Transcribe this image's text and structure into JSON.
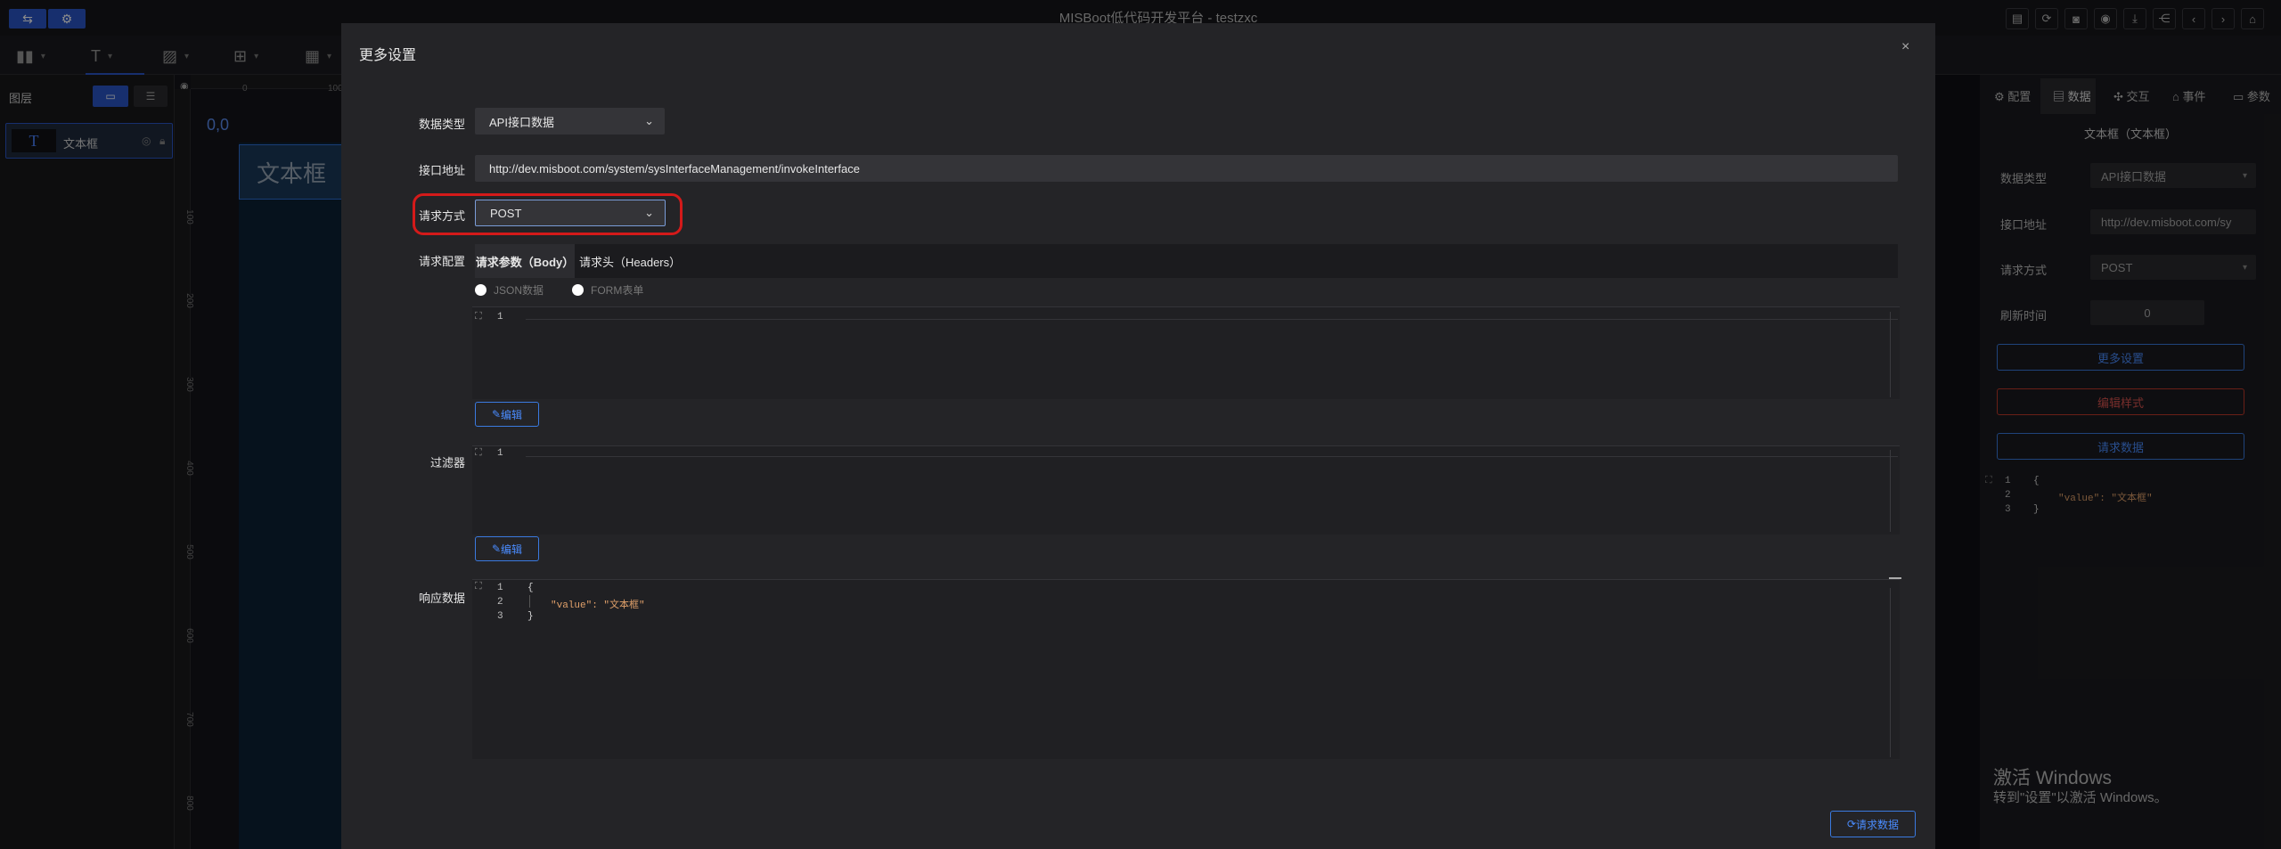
{
  "app": {
    "title": "MISBoot低代码开发平台 - testzxc"
  },
  "toolbar": {
    "left_buttons": [
      "⇆",
      "⚙"
    ],
    "right_icons": [
      "save-icon",
      "refresh-icon",
      "camera-icon",
      "eye-icon",
      "download-icon",
      "share-icon",
      "chevron-left-icon",
      "chevron-right-icon",
      "home-icon"
    ],
    "tools": [
      "chart-tool",
      "text-tool",
      "image-tool",
      "component-tool",
      "table-tool"
    ]
  },
  "layers": {
    "title": "图层",
    "items": [
      {
        "icon": "T",
        "label": "文本框"
      }
    ]
  },
  "canvas": {
    "origin": "0,0",
    "ruler_h": [
      "0",
      "100"
    ],
    "ruler_v": [
      "100",
      "200",
      "300",
      "400",
      "500",
      "600",
      "700",
      "800"
    ],
    "textbox_label": "文本框"
  },
  "right_panel": {
    "tabs": [
      "配置",
      "数据",
      "交互",
      "事件",
      "参数"
    ],
    "active_tab": "数据",
    "subtitle": "文本框（文本框）",
    "fields": [
      {
        "label": "数据类型",
        "value": "API接口数据"
      },
      {
        "label": "接口地址",
        "value": "http://dev.misboot.com/sy"
      },
      {
        "label": "请求方式",
        "value": "POST"
      },
      {
        "label": "刷新时间",
        "value": "0"
      }
    ],
    "buttons": {
      "more_settings": "更多设置",
      "edit_style": "编辑样式",
      "request_data": "请求数据"
    },
    "code_lines": [
      "{",
      "\"value\": \"文本框\"",
      "}"
    ]
  },
  "activate": {
    "line1": "激活 Windows",
    "line2": "转到\"设置\"以激活 Windows。"
  },
  "modal": {
    "title": "更多设置",
    "close": "×",
    "data_type": {
      "label": "数据类型",
      "value": "API接口数据"
    },
    "api_url": {
      "label": "接口地址",
      "value": "http://dev.misboot.com/system/sysInterfaceManagement/invokeInterface"
    },
    "method": {
      "label": "请求方式",
      "value": "POST"
    },
    "request_config": {
      "label": "请求配置",
      "tabs": [
        "请求参数（Body）",
        "请求头（Headers）"
      ],
      "radios": [
        "JSON数据",
        "FORM表单"
      ]
    },
    "editor_body": {
      "line": "1",
      "edit": "编辑"
    },
    "filter": {
      "label": "过滤器",
      "line": "1",
      "edit": "编辑"
    },
    "response": {
      "label": "响应数据",
      "lines": [
        "1",
        "2",
        "3"
      ],
      "code": [
        "{",
        "\"value\": \"文本框\"",
        "}"
      ]
    },
    "request_button": "请求数据"
  }
}
